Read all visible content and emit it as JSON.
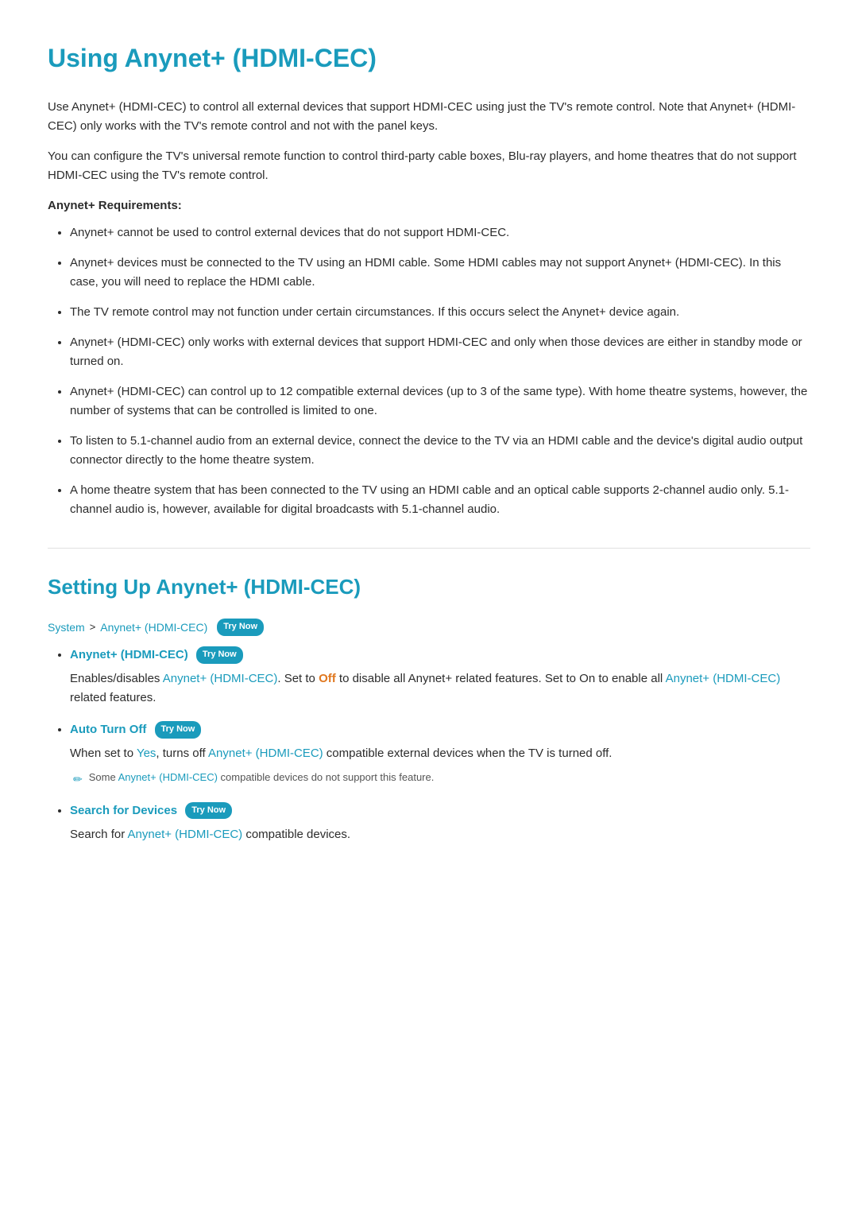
{
  "page": {
    "main_title": "Using Anynet+ (HDMI-CEC)",
    "intro_para1": "Use Anynet+ (HDMI-CEC) to control all external devices that support HDMI-CEC using just the TV's remote control. Note that Anynet+ (HDMI-CEC) only works with the TV's remote control and not with the panel keys.",
    "intro_para2": "You can configure the TV's universal remote function to control third-party cable boxes, Blu-ray players, and home theatres that do not support HDMI-CEC using the TV's remote control.",
    "requirements_heading": "Anynet+ Requirements:",
    "requirements": [
      "Anynet+ cannot be used to control external devices that do not support HDMI-CEC.",
      "Anynet+ devices must be connected to the TV using an HDMI cable. Some HDMI cables may not support Anynet+ (HDMI-CEC). In this case, you will need to replace the HDMI cable.",
      "The TV remote control may not function under certain circumstances. If this occurs select the Anynet+ device again.",
      "Anynet+ (HDMI-CEC) only works with external devices that support HDMI-CEC and only when those devices are either in standby mode or turned on.",
      "Anynet+ (HDMI-CEC) can control up to 12 compatible external devices (up to 3 of the same type). With home theatre systems, however, the number of systems that can be controlled is limited to one.",
      "To listen to 5.1-channel audio from an external device, connect the device to the TV via an HDMI cable and the device's digital audio output connector directly to the home theatre system.",
      "A home theatre system that has been connected to the TV using an HDMI cable and an optical cable supports 2-channel audio only. 5.1-channel audio is, however, available for digital broadcasts with 5.1-channel audio."
    ],
    "section_title": "Setting Up Anynet+ (HDMI-CEC)",
    "breadcrumb": {
      "system": "System",
      "separator": ">",
      "anynet": "Anynet+ (HDMI-CEC)",
      "try_now": "Try Now"
    },
    "settings": [
      {
        "title": "Anynet+ (HDMI-CEC)",
        "try_now": true,
        "description_parts": [
          "Enables/disables ",
          "Anynet+ (HDMI-CEC)",
          ". Set to ",
          "Off",
          " to disable all Anynet+ related features. Set to On to enable all ",
          "Anynet+ (HDMI-CEC)",
          " related features."
        ]
      },
      {
        "title": "Auto Turn Off",
        "try_now": true,
        "description_parts": [
          "When set to ",
          "Yes",
          ", turns off ",
          "Anynet+ (HDMI-CEC)",
          " compatible external devices when the TV is turned off."
        ],
        "note": {
          "icon": "✏",
          "text_parts": [
            "Some ",
            "Anynet+ (HDMI-CEC)",
            " compatible devices do not support this feature."
          ]
        }
      },
      {
        "title": "Search for Devices",
        "try_now": true,
        "description_parts": [
          "Search for ",
          "Anynet+ (HDMI-CEC)",
          " compatible devices."
        ]
      }
    ],
    "try_now_label": "Try Now",
    "yes_label": "Yes",
    "off_label": "Off"
  }
}
